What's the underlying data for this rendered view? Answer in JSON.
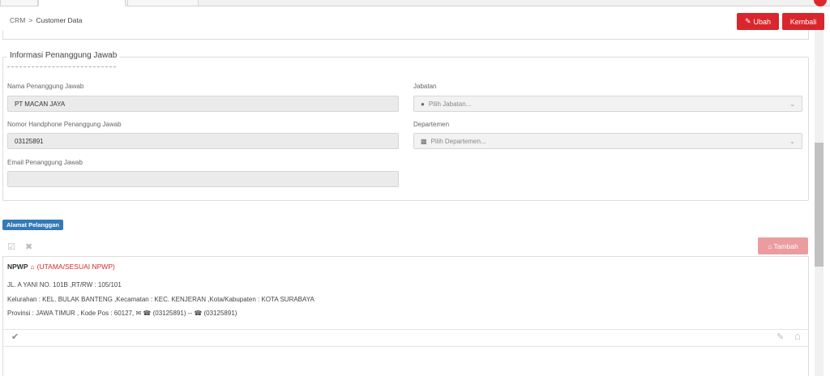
{
  "breadcrumb": {
    "root": "CRM",
    "separator": ">",
    "current": "Customer Data"
  },
  "actions": {
    "edit_label": "Ubah",
    "back_label": "Kembali"
  },
  "section": {
    "title": "Informasi Penanggung Jawab",
    "name_label": "Nama Penanggung Jawab",
    "name_value": "PT MACAN JAYA",
    "phone_label": "Nomor Handphone Penanggung Jawab",
    "phone_value": "03125891",
    "email_label": "Email Penanggung Jawab",
    "email_value": "",
    "position_label": "Jabatan",
    "position_placeholder": "Pilih Jabatan...",
    "department_label": "Departemen",
    "department_placeholder": "Pilih Departemen..."
  },
  "address": {
    "badge": "Alamat Pelanggan",
    "add_label": "Tambah",
    "type": "NPWP",
    "type_note": "(UTAMA/SESUAI NPWP)",
    "line1": "JL. A YANI NO. 101B ,RT/RW : 105/101",
    "line2": "Kelurahan : KEL. BULAK BANTENG ,Kecamatan : KEC. KENJERAN ,Kota/Kabupaten : KOTA SURABAYA",
    "line3_prefix": "Provinsi : JAWA TIMUR , Kode Pos : 60127,",
    "phone_a": "(03125891)",
    "phone_sep": "--",
    "phone_b": "(03125891)"
  },
  "colors": {
    "primary_red": "#d9262d",
    "badge_blue": "#337ab7"
  }
}
